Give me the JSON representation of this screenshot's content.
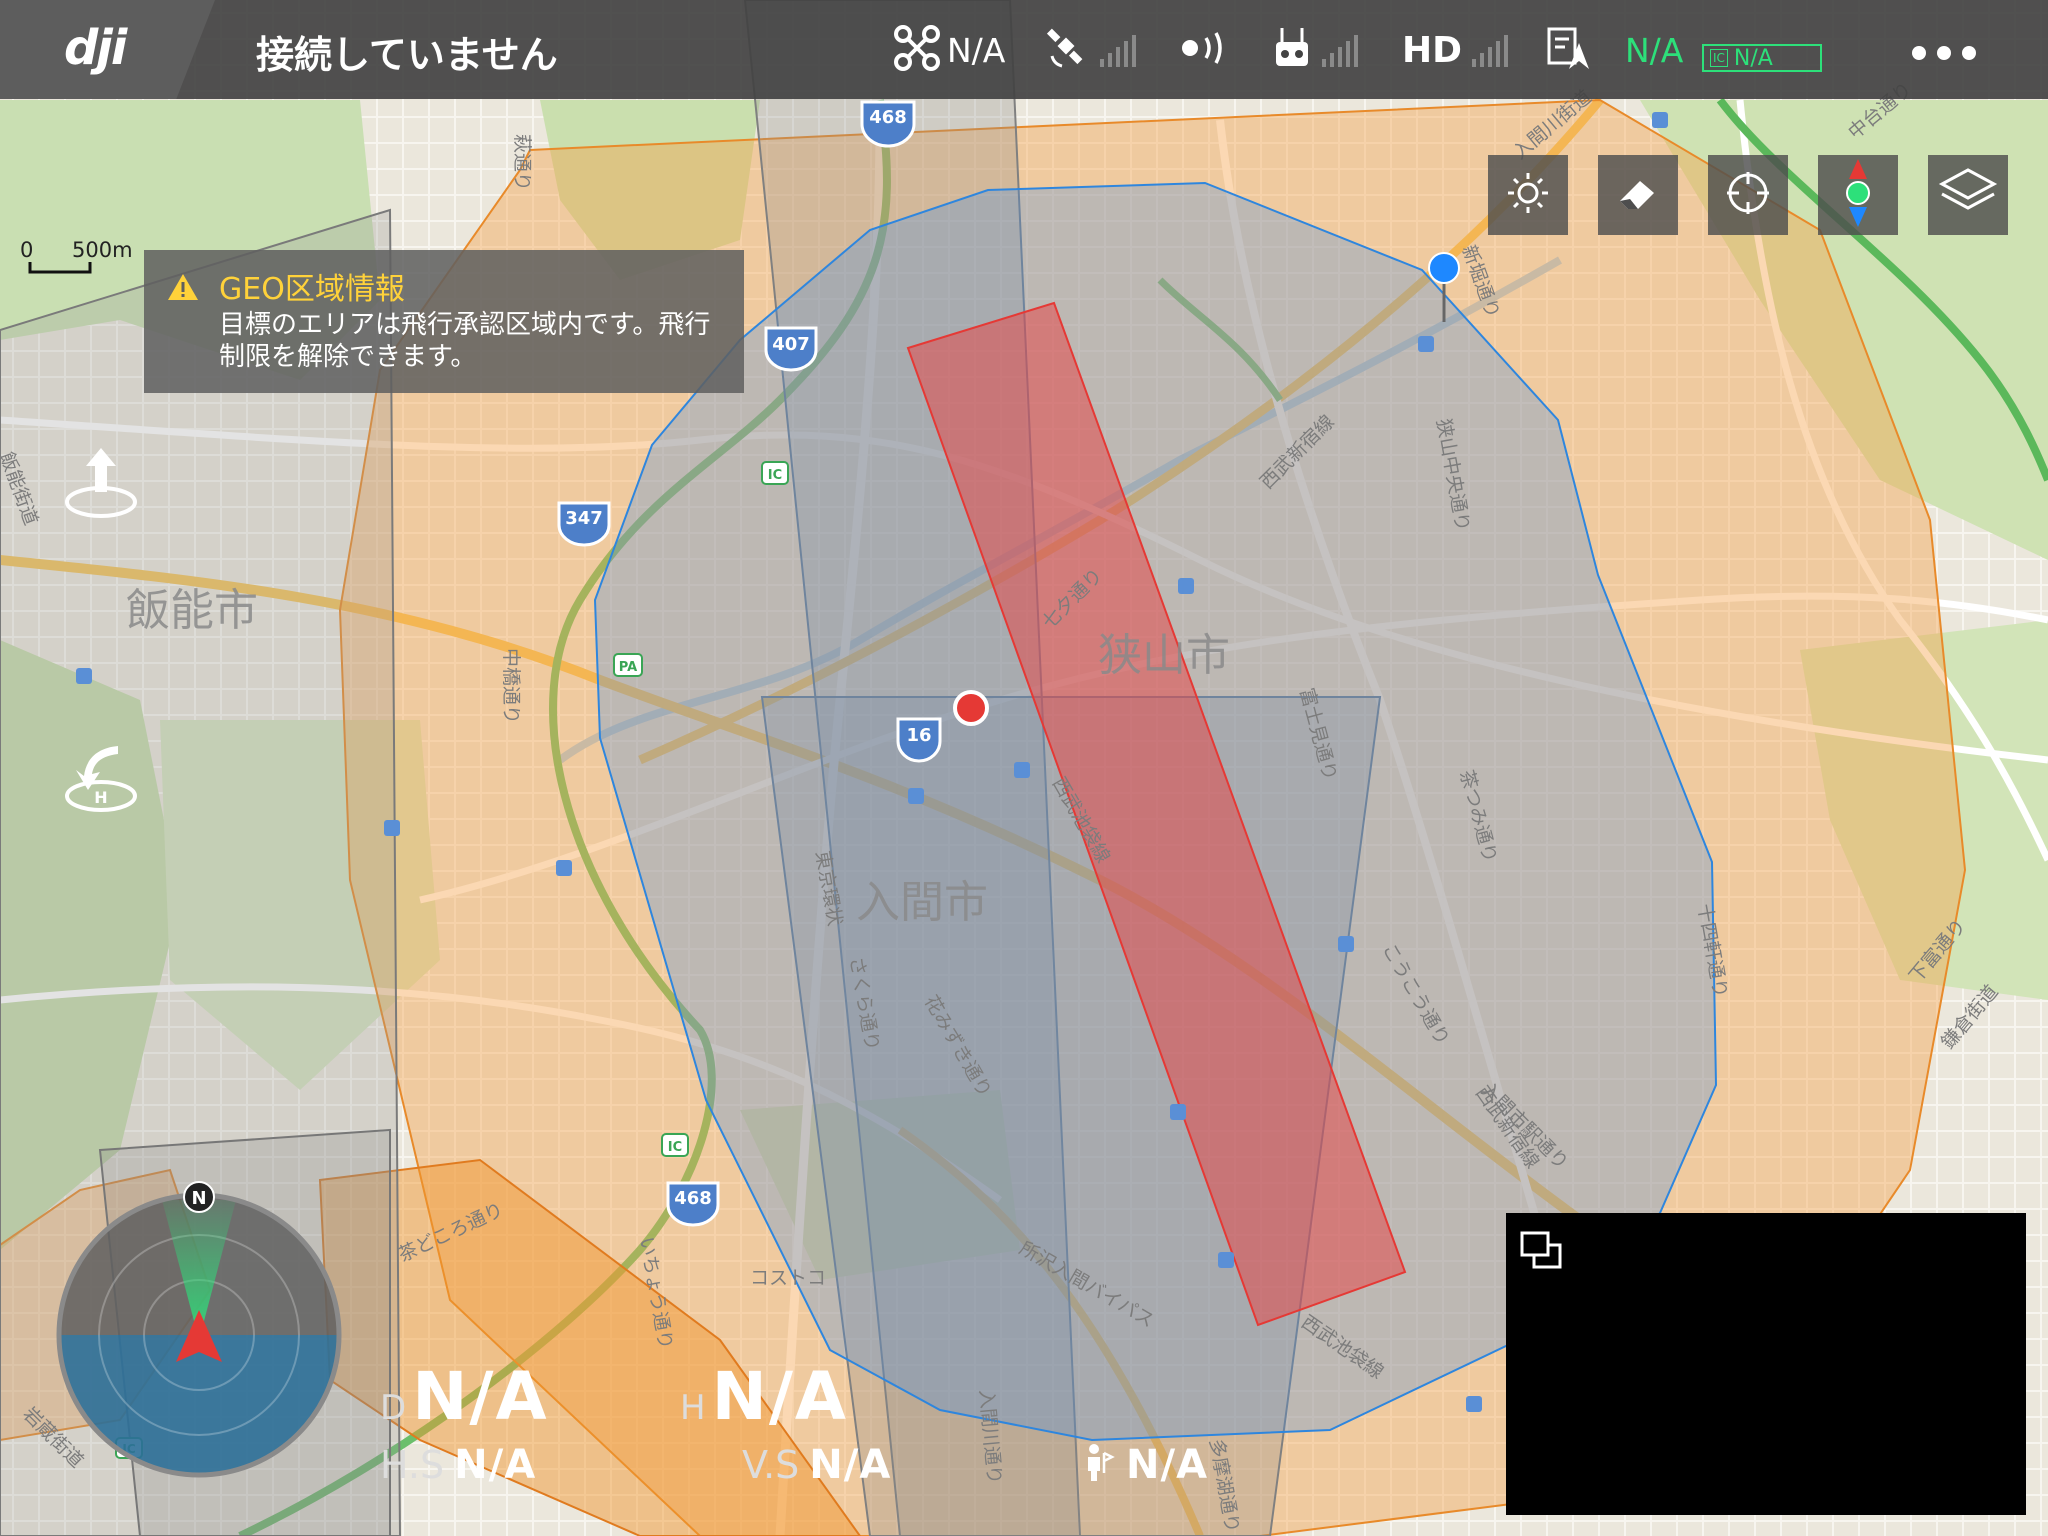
{
  "app": {
    "logo": "dji",
    "connection_status": "接続していません"
  },
  "status_bar": {
    "aircraft_mode": "N/A",
    "video_label": "HD",
    "battery_percent": "N/A",
    "battery_bar_text": "N/A",
    "colors": {
      "battery": "#2de07a",
      "bar": "#424242"
    }
  },
  "scale_bar": {
    "zero": "0",
    "distance": "500m"
  },
  "geo_info": {
    "title": "GEO区域情報",
    "message": "目標のエリアは飛行承認区域内です。飛行制限を解除できます。"
  },
  "map": {
    "cities": [
      "飯能市",
      "狭山市",
      "入間市"
    ],
    "route_shields": [
      "468",
      "407",
      "347",
      "16",
      "468"
    ],
    "interchange_badges": [
      "IC",
      "IC",
      "PA",
      "IC"
    ],
    "road_labels": [
      "萩通り",
      "入間川街道",
      "中台通り",
      "新堀通り",
      "狭山中央通り",
      "西武新宿線",
      "七夕通り",
      "中橋通り",
      "富士見通り",
      "茶つみ通り",
      "東京環状",
      "西武池袋線",
      "花みずき通り",
      "さくら通り",
      "こうこう通り",
      "入間市駅通り",
      "十四軒通り",
      "下富通り",
      "所沢入間バイパス",
      "いちょう通り",
      "茶どころ通り",
      "岩蔵街道",
      "鎌倉街道",
      "西武新宿線",
      "多摩湖通り",
      "西武池袋線",
      "飯能街道",
      "入間川通り"
    ],
    "poi_label": "コストコ",
    "colors": {
      "orange_zone": "#f5a24a",
      "blue_zone": "#4a90e2",
      "red_zone": "#e64545",
      "gray_zone": "#8a8a8a"
    }
  },
  "compass": {
    "north_label": "N"
  },
  "telemetry": {
    "distance_prefix": "D",
    "distance_value": "N/A",
    "height_prefix": "H",
    "height_value": "N/A",
    "hs_prefix": "H.S",
    "hs_value": "N/A",
    "vs_prefix": "V.S",
    "vs_value": "N/A",
    "pilot_distance_value": "N/A"
  }
}
